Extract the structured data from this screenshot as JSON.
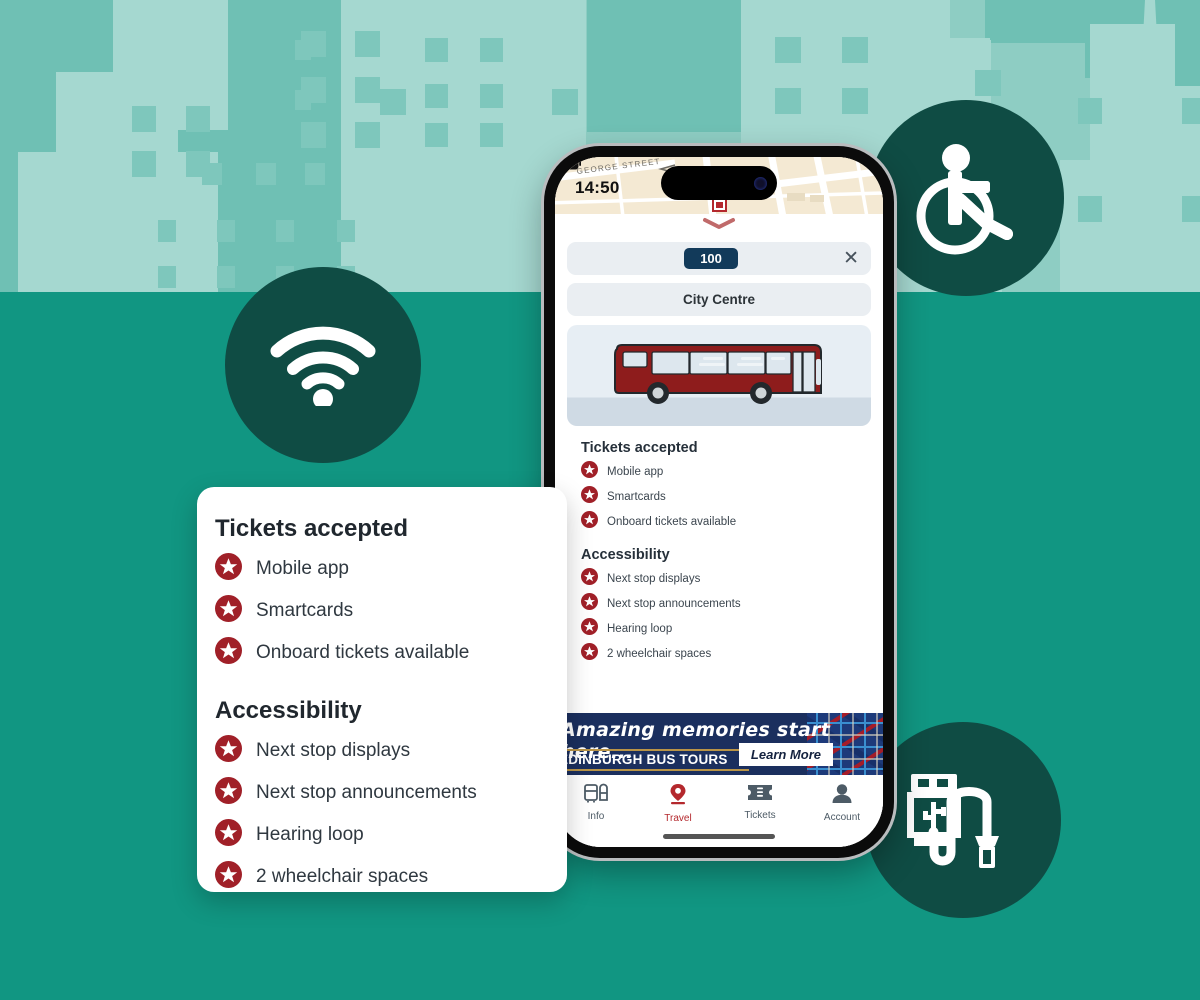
{
  "theme": {
    "brand_teal": "#119682",
    "sky_teal": "#8ecdc3",
    "deep_green": "#0f4c44",
    "accent_red": "#a52028",
    "navy": "#123a5a",
    "ad_navy": "#1b2f5e"
  },
  "feature_badges": [
    {
      "name": "wifi-icon",
      "label": "Wi-Fi"
    },
    {
      "name": "wheelchair-accessible-icon",
      "label": "Wheelchair accessible"
    },
    {
      "name": "usb-charging-icon",
      "label": "USB charging"
    }
  ],
  "phone": {
    "status_bar": {
      "time": "14:50",
      "wifi_icon": "wifi-icon",
      "battery_icon": "battery-icon"
    },
    "map": {
      "street_label": "GEORGE STREET"
    },
    "sheet": {
      "handle_icon": "chevron-down-icon",
      "route_badge": "100",
      "close_icon": "close-icon",
      "destination": "City Centre",
      "bus_image_alt": "red-single-decker-bus",
      "sections": [
        {
          "title": "Tickets accepted",
          "items": [
            "Mobile app",
            "Smartcards",
            "Onboard tickets available"
          ]
        },
        {
          "title": "Accessibility",
          "items": [
            "Next stop displays",
            "Next stop announcements",
            "Hearing loop",
            "2 wheelchair spaces"
          ]
        }
      ]
    },
    "ad": {
      "headline": "Amazing memories start here...",
      "brand": "EDINBURGH BUS TOURS",
      "cta": "Learn More"
    },
    "bottom_nav": [
      {
        "label": "Info",
        "icon": "timetable-icon",
        "active": false
      },
      {
        "label": "Travel",
        "icon": "map-pin-icon",
        "active": true
      },
      {
        "label": "Tickets",
        "icon": "ticket-icon",
        "active": false
      },
      {
        "label": "Account",
        "icon": "person-icon",
        "active": false
      }
    ]
  },
  "callout": {
    "sections": [
      {
        "title": "Tickets accepted",
        "items": [
          "Mobile app",
          "Smartcards",
          "Onboard tickets available"
        ]
      },
      {
        "title": "Accessibility",
        "items": [
          "Next stop displays",
          "Next stop announcements",
          "Hearing loop",
          "2 wheelchair spaces"
        ]
      }
    ]
  }
}
